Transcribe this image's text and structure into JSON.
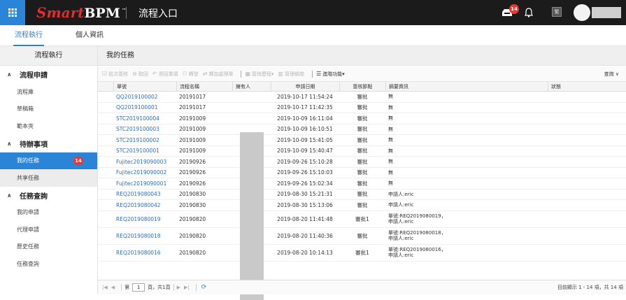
{
  "header": {
    "logo_smart": "Smart",
    "logo_bpm": "BPM",
    "logo_tm": "™",
    "app_title": "流程入口",
    "notification_count": "14",
    "square_label": "繁"
  },
  "tabs": [
    {
      "label": "流程執行"
    },
    {
      "label": "個人資訊"
    }
  ],
  "sidebar": {
    "title": "流程執行",
    "sections": [
      {
        "label": "流程申請",
        "items": [
          "流程庫",
          "草稿箱",
          "範本夾"
        ]
      },
      {
        "label": "待辦事項",
        "items": [
          "我的任務",
          "共享任務"
        ],
        "badge": "14"
      },
      {
        "label": "任務查詢",
        "items": [
          "我的申請",
          "代理申請",
          "歷史任務",
          "任務查詢"
        ]
      }
    ]
  },
  "main": {
    "title": "我的任務",
    "toolbar": [
      "批次簽核",
      "取回",
      "退回重填",
      "轉發",
      "轉加處理單",
      "簽核歷程",
      "管理朝度",
      "進階功能"
    ],
    "query": "查詢"
  },
  "table": {
    "columns": [
      "單號",
      "流程名稱",
      "擁有人",
      "申請日期",
      "簽核節點",
      "摘要資訊",
      "狀態"
    ],
    "rows": [
      {
        "no": "QQ2019100002",
        "flow": "20191017",
        "date": "2019-10-17 11:54:24",
        "node": "審批",
        "summary": [
          "無"
        ]
      },
      {
        "no": "QQ2019100001",
        "flow": "20191017",
        "date": "2019-10-17 11:42:35",
        "node": "審批",
        "summary": [
          "無"
        ]
      },
      {
        "no": "STC2019100004",
        "flow": "20191009",
        "date": "2019-10-09 16:11:04",
        "node": "審批",
        "summary": [
          "無"
        ]
      },
      {
        "no": "STC2019100003",
        "flow": "20191009",
        "date": "2019-10-09 16:10:51",
        "node": "審批",
        "summary": [
          "無"
        ]
      },
      {
        "no": "STC2019100002",
        "flow": "20191009",
        "date": "2019-10-09 15:41:05",
        "node": "審批",
        "summary": [
          "無"
        ]
      },
      {
        "no": "STC2019100001",
        "flow": "20191009",
        "date": "2019-10-09 15:40:47",
        "node": "審批",
        "summary": [
          "無"
        ]
      },
      {
        "no": "Fujitec2019090003",
        "flow": "20190926",
        "date": "2019-09-26 15:10:28",
        "node": "審批",
        "summary": [
          "無"
        ]
      },
      {
        "no": "Fujitec2019090002",
        "flow": "20190926",
        "date": "2019-09-26 15:10:03",
        "node": "審批",
        "summary": [
          "無"
        ]
      },
      {
        "no": "Fujitec2019090001",
        "flow": "20190926",
        "date": "2019-09-26 15:02:34",
        "node": "審批",
        "summary": [
          "無"
        ]
      },
      {
        "no": "REQ2019080043",
        "flow": "20190830",
        "date": "2019-08-30 15:21:31",
        "node": "審批",
        "summary": [
          "申請人:eric"
        ]
      },
      {
        "no": "REQ2019080042",
        "flow": "20190830",
        "date": "2019-08-30 15:13:06",
        "node": "審批",
        "summary": [
          "申請人:eric"
        ]
      },
      {
        "no": "REQ2019080019",
        "flow": "20190820",
        "date": "2019-08-20 11:41:48",
        "node": "審批1",
        "summary": [
          "單號:REQ2019080019，",
          "申請人:eric"
        ]
      },
      {
        "no": "REQ2019080018",
        "flow": "20190820",
        "date": "2019-08-20 11:40:36",
        "node": "審批",
        "summary": [
          "單號:REQ2019080018，",
          "申請人:eric"
        ]
      },
      {
        "no": "REQ2019080016",
        "flow": "20190820",
        "date": "2019-08-20 10:14:13",
        "node": "審批1",
        "summary": [
          "單號:REQ2019080016，",
          "申請人:eric"
        ]
      }
    ]
  },
  "pager": {
    "page_label": "第",
    "page_value": "1",
    "page_total": "頁，共1頁",
    "info": "目前顯示 1 - 14 項，共 14 項"
  }
}
